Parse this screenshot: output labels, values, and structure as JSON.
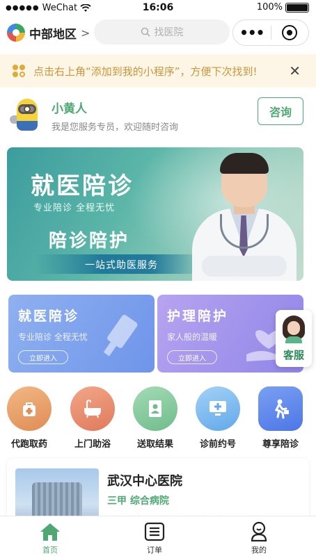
{
  "status_bar": {
    "signal": "●●●●●",
    "carrier": "WeChat",
    "time": "16:06",
    "battery": "100%"
  },
  "nav": {
    "location": "中部地区",
    "location_arrow": ">",
    "search_placeholder": "找医院",
    "more": "•••"
  },
  "tip": {
    "text": "点击右上角“添加到我的小程序”，方便下次找到!",
    "close": "✕"
  },
  "agent": {
    "name": "小黄人",
    "desc": "我是您服务专员，欢迎随时咨询",
    "button": "咨询"
  },
  "banner": {
    "title": "就医陪诊",
    "subtitle": "专业陪诊 全程无忧",
    "title2": "陪诊陪护",
    "strip": "一站式助医服务"
  },
  "cards": [
    {
      "title": "就医陪诊",
      "subtitle": "专业陪诊 全程无忧",
      "button": "立即进入"
    },
    {
      "title": "护理陪护",
      "subtitle": "家人般的温暖",
      "button": "立即进入"
    }
  ],
  "customer_service": {
    "label": "客服"
  },
  "quick_items": [
    {
      "label": "代跑取药",
      "icon": "medicine-bag-icon",
      "color": "#e9a06b"
    },
    {
      "label": "上门助浴",
      "icon": "bathtub-icon",
      "color": "#ea8f6e"
    },
    {
      "label": "送取结果",
      "icon": "report-icon",
      "color": "#7fc79a"
    },
    {
      "label": "诊前约号",
      "icon": "monitor-icon",
      "color": "#74b6ee"
    },
    {
      "label": "尊享陪诊",
      "icon": "walking-person-icon",
      "color": "#5b86ea"
    }
  ],
  "hospital": {
    "name": "武汉中心医院",
    "tags": "三甲  综合病院",
    "desc": "武汉市中心医院是一家位于中国湖北省"
  },
  "tabs": [
    {
      "label": "首页",
      "icon": "home-icon",
      "active": true
    },
    {
      "label": "订单",
      "icon": "order-list-icon",
      "active": false
    },
    {
      "label": "我的",
      "icon": "profile-icon",
      "active": false
    }
  ],
  "colors": {
    "brand_green": "#4fa874",
    "tip_text": "#c9963a",
    "tip_bg": "#fdf6e6"
  }
}
